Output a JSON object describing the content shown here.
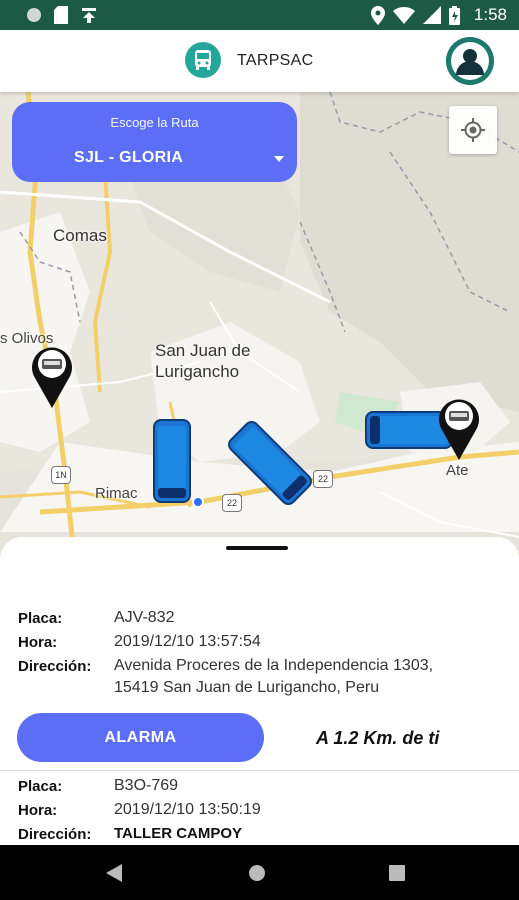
{
  "status_bar": {
    "time": "1:58"
  },
  "app_bar": {
    "title": "TARPSAC"
  },
  "route_selector": {
    "title": "Escoge la Ruta",
    "selected": "SJL - GLORIA"
  },
  "map": {
    "labels": [
      "Comas",
      "s Olivos",
      "San Juan de Lurigancho",
      "Rimac",
      "Ate"
    ],
    "shields": [
      "1N",
      "22",
      "22"
    ]
  },
  "buses": [
    {
      "placa_label": "Placa:",
      "placa": "AJV-832",
      "hora_label": "Hora:",
      "hora": "2019/12/10 13:57:54",
      "direccion_label": "Dirección:",
      "direccion_line1": "Avenida Proceres de la Independencia 1303,",
      "direccion_line2": "15419 San Juan de Lurigancho, Peru"
    },
    {
      "placa_label": "Placa:",
      "placa": "B3O-769",
      "hora_label": "Hora:",
      "hora": "2019/12/10 13:50:19",
      "direccion_label": "Dirección:",
      "direccion_line1": "TALLER CAMPOY"
    }
  ],
  "alarm": {
    "label": "ALARMA",
    "distance": "A 1.2 Km. de ti"
  },
  "colors": {
    "status_bar": "#1d5a45",
    "accent": "#5b6ef5",
    "teal": "#26a69a",
    "bus_blue": "#1976d2"
  },
  "icons": {
    "status_left": [
      "circle-icon",
      "sd-card-icon",
      "download-icon"
    ],
    "status_right": [
      "location-icon",
      "wifi-icon",
      "signal-icon",
      "battery-icon"
    ],
    "nav": [
      "back-icon",
      "home-icon",
      "recents-icon"
    ]
  }
}
